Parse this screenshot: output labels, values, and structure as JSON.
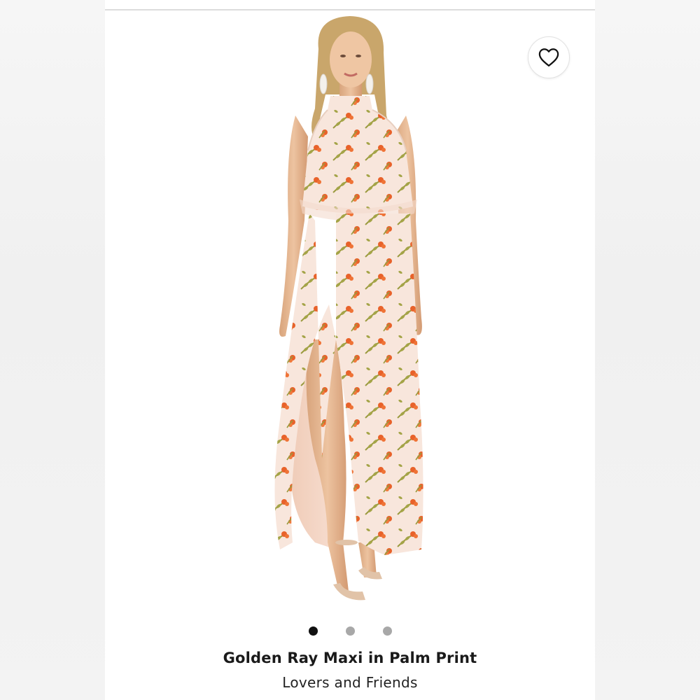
{
  "product": {
    "title": "Golden Ray Maxi in Palm Print",
    "brand": "Lovers and Friends"
  },
  "favorite": {
    "icon": "heart-outline-icon"
  },
  "carousel": {
    "slide_count": 3,
    "active_index": 0
  },
  "colors": {
    "dress_base": "#f8e6dc",
    "flower": "#e8622a",
    "leaf": "#9a9a3e",
    "skin": "#e6b48f",
    "hair": "#c9a66b",
    "dot_active": "#111111",
    "dot_inactive": "#a8a8a8"
  }
}
